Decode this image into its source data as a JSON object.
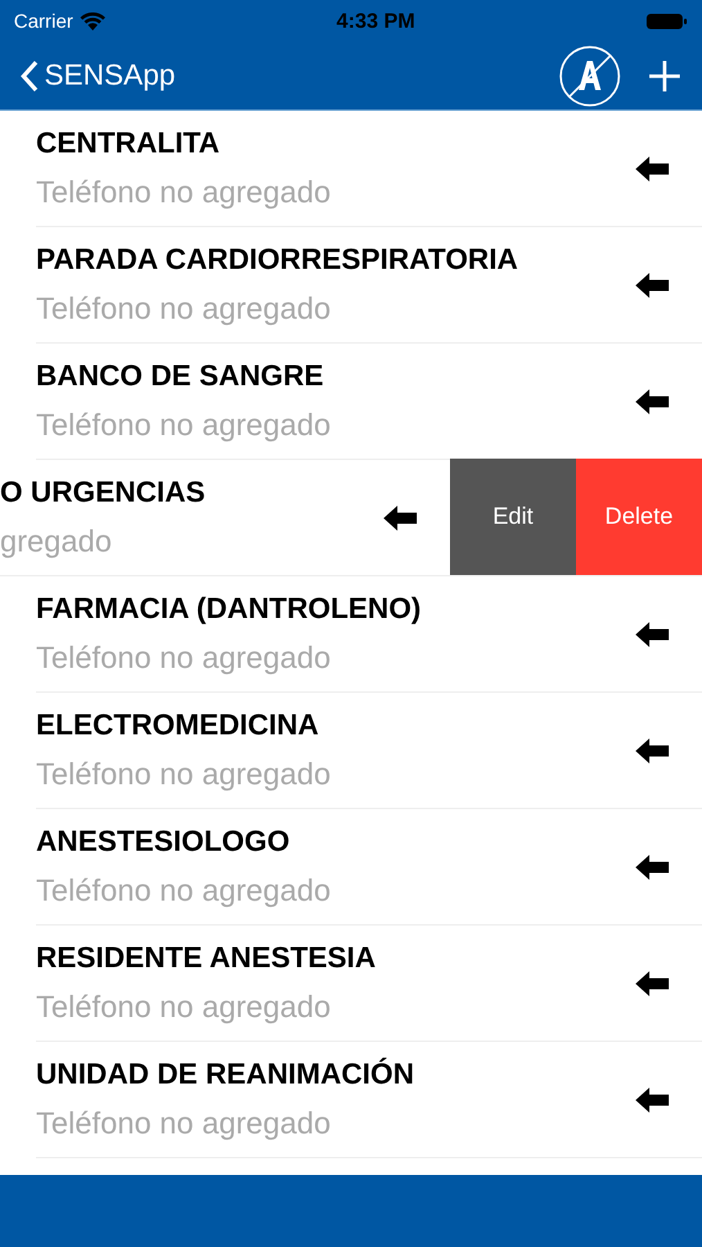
{
  "status_bar": {
    "carrier": "Carrier",
    "time": "4:33 PM"
  },
  "nav": {
    "back_label": "SENSApp"
  },
  "rows": [
    {
      "title": "CENTRALITA",
      "subtitle": "Teléfono no agregado",
      "swiped": false
    },
    {
      "title": "PARADA CARDIORRESPIRATORIA",
      "subtitle": "Teléfono no agregado",
      "swiped": false
    },
    {
      "title": "BANCO DE SANGRE",
      "subtitle": "Teléfono no agregado",
      "swiped": false
    },
    {
      "title": "O URGENCIAS",
      "subtitle": "gregado",
      "swiped": true,
      "actions": [
        {
          "label": "Edit",
          "kind": "edit"
        },
        {
          "label": "Delete",
          "kind": "delete"
        }
      ]
    },
    {
      "title": "FARMACIA (DANTROLENO)",
      "subtitle": "Teléfono no agregado",
      "swiped": false
    },
    {
      "title": "ELECTROMEDICINA",
      "subtitle": "Teléfono no agregado",
      "swiped": false
    },
    {
      "title": "ANESTESIOLOGO",
      "subtitle": "Teléfono no agregado",
      "swiped": false
    },
    {
      "title": "RESIDENTE ANESTESIA",
      "subtitle": "Teléfono no agregado",
      "swiped": false
    },
    {
      "title": "UNIDAD DE REANIMACIÓN",
      "subtitle": "Teléfono no agregado",
      "swiped": false
    }
  ]
}
